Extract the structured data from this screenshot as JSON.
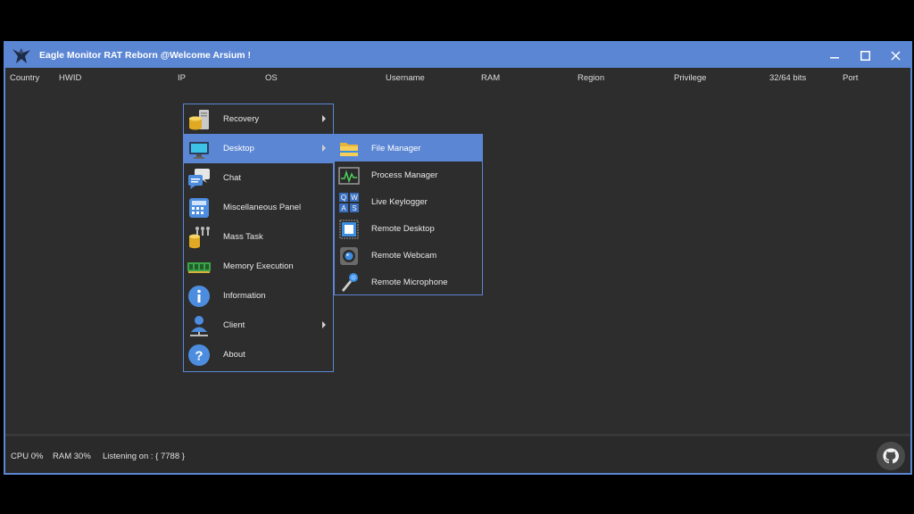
{
  "window": {
    "title": "Eagle Monitor RAT Reborn @Welcome Arsium !",
    "controls": {
      "minimize": "—",
      "maximize": "☐",
      "close": "✕"
    }
  },
  "columns": [
    "Country",
    "HWID",
    "IP",
    "OS",
    "Username",
    "RAM",
    "Region",
    "Privilege",
    "32/64 bits",
    "Port"
  ],
  "context_menu": {
    "items": [
      {
        "label": "Recovery",
        "icon": "database-server-icon",
        "has_submenu": true
      },
      {
        "label": "Desktop",
        "icon": "monitor-icon",
        "has_submenu": true,
        "selected": true
      },
      {
        "label": "Chat",
        "icon": "chat-bubbles-icon",
        "has_submenu": false
      },
      {
        "label": "Miscellaneous Panel",
        "icon": "calculator-icon",
        "has_submenu": false
      },
      {
        "label": "Mass Task",
        "icon": "database-network-icon",
        "has_submenu": false
      },
      {
        "label": "Memory Execution",
        "icon": "memory-chip-icon",
        "has_submenu": false
      },
      {
        "label": "Information",
        "icon": "info-icon",
        "has_submenu": false
      },
      {
        "label": "Client",
        "icon": "user-network-icon",
        "has_submenu": true
      },
      {
        "label": "About",
        "icon": "question-icon",
        "has_submenu": false
      }
    ]
  },
  "desktop_submenu": {
    "items": [
      {
        "label": "File Manager",
        "icon": "folder-icon",
        "selected": true
      },
      {
        "label": "Process Manager",
        "icon": "activity-monitor-icon"
      },
      {
        "label": "Live Keylogger",
        "icon": "keyboard-keys-icon",
        "keys": [
          "Q",
          "W",
          "A",
          "S"
        ]
      },
      {
        "label": "Remote Desktop",
        "icon": "remote-desktop-icon"
      },
      {
        "label": "Remote Webcam",
        "icon": "webcam-icon"
      },
      {
        "label": "Remote Microphone",
        "icon": "microphone-icon"
      }
    ]
  },
  "status": {
    "cpu": "CPU 0%",
    "ram": "RAM 30%",
    "listening": "Listening on : { 7788 }"
  },
  "colors": {
    "accent": "#5b86d4",
    "background": "#2d2d2d",
    "menu_border": "#5b86d4"
  }
}
